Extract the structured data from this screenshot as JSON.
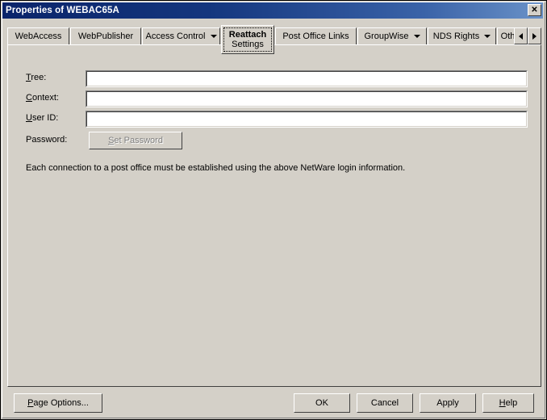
{
  "window": {
    "title": "Properties of WEBAC65A",
    "close_icon": "close-icon",
    "close_glyph": "✕",
    "background_color": "#d4d0c8",
    "titlebar_color_start": "#0a246a",
    "titlebar_color_end": "#6a92c8"
  },
  "tabs": [
    {
      "label": "WebAccess",
      "has_dropdown": false,
      "active": false
    },
    {
      "label": "WebPublisher",
      "has_dropdown": false,
      "active": false
    },
    {
      "label": "Access Control",
      "has_dropdown": true,
      "active": false
    },
    {
      "label": "Reattach",
      "label_line2": "Settings",
      "has_dropdown": false,
      "active": true
    },
    {
      "label": "Post Office Links",
      "has_dropdown": false,
      "active": false
    },
    {
      "label": "GroupWise",
      "has_dropdown": true,
      "active": false
    },
    {
      "label": "NDS Rights",
      "has_dropdown": true,
      "active": false
    },
    {
      "label": "Oth",
      "has_dropdown": false,
      "active": false,
      "clipped": true
    }
  ],
  "tab_scroll": {
    "left_label": "◀",
    "right_label": "▶",
    "left_icon": "scroll-left-icon",
    "right_icon": "scroll-right-icon"
  },
  "form": {
    "fields": [
      {
        "label_pre": "T",
        "label_post": "ree:",
        "value": "",
        "placeholder": ""
      },
      {
        "label_pre": "C",
        "label_post": "ontext:",
        "value": "",
        "placeholder": ""
      },
      {
        "label_pre": "U",
        "label_post": "ser ID:",
        "value": "",
        "placeholder": ""
      }
    ],
    "password_label": "Password:",
    "password_button": {
      "pre": "S",
      "post": "et Password",
      "enabled": false
    }
  },
  "info_text": "Each connection to a post office must be established using the above NetWare login information.",
  "footer": {
    "page_options": {
      "pre": "P",
      "post": "age Options..."
    },
    "ok": "OK",
    "cancel": "Cancel",
    "apply": "Apply",
    "help": {
      "pre": "H",
      "post": "elp"
    }
  }
}
